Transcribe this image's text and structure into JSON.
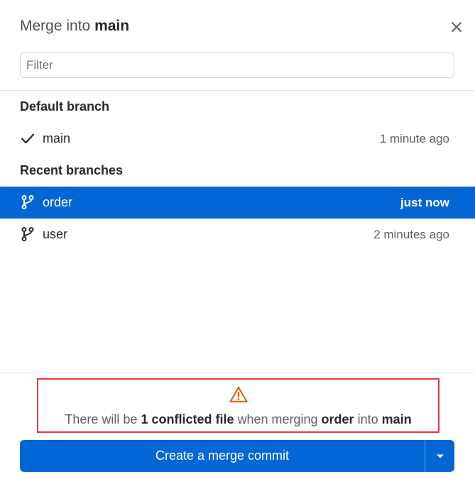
{
  "header": {
    "title_prefix": "Merge into",
    "title_branch": "main"
  },
  "filter": {
    "placeholder": "Filter",
    "value": ""
  },
  "default_section": {
    "label": "Default branch",
    "branches": [
      {
        "name": "main",
        "time": "1 minute ago",
        "icon": "check-icon"
      }
    ]
  },
  "recent_section": {
    "label": "Recent branches",
    "branches": [
      {
        "name": "order",
        "time": "just now",
        "icon": "git-branch-icon",
        "selected": true
      },
      {
        "name": "user",
        "time": "2 minutes ago",
        "icon": "git-branch-icon",
        "selected": false
      }
    ]
  },
  "warning": {
    "icon": "warning-icon",
    "text_part1": "There will be ",
    "conflict_count_text": "1 conflicted file",
    "text_part2": " when merging ",
    "source_branch": "order",
    "text_part3": " into ",
    "target_branch": "main"
  },
  "merge_button": {
    "label": "Create a merge commit",
    "dropdown_icon": "caret-down-icon"
  },
  "colors": {
    "accent": "#0366d6",
    "warning_icon": "#e36209",
    "highlight_border": "#e5363b"
  }
}
